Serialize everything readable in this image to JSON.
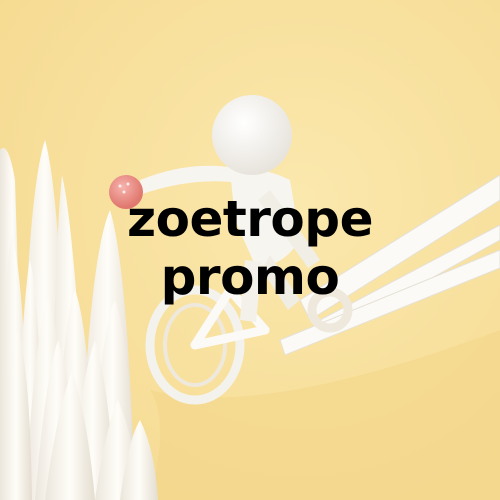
{
  "title": {
    "line1": "zoetrope",
    "line2": "promo"
  },
  "colors": {
    "background": "#f8e29f",
    "figure": "#fbfaf6",
    "ball": "#e98f88",
    "text": "#000000"
  }
}
